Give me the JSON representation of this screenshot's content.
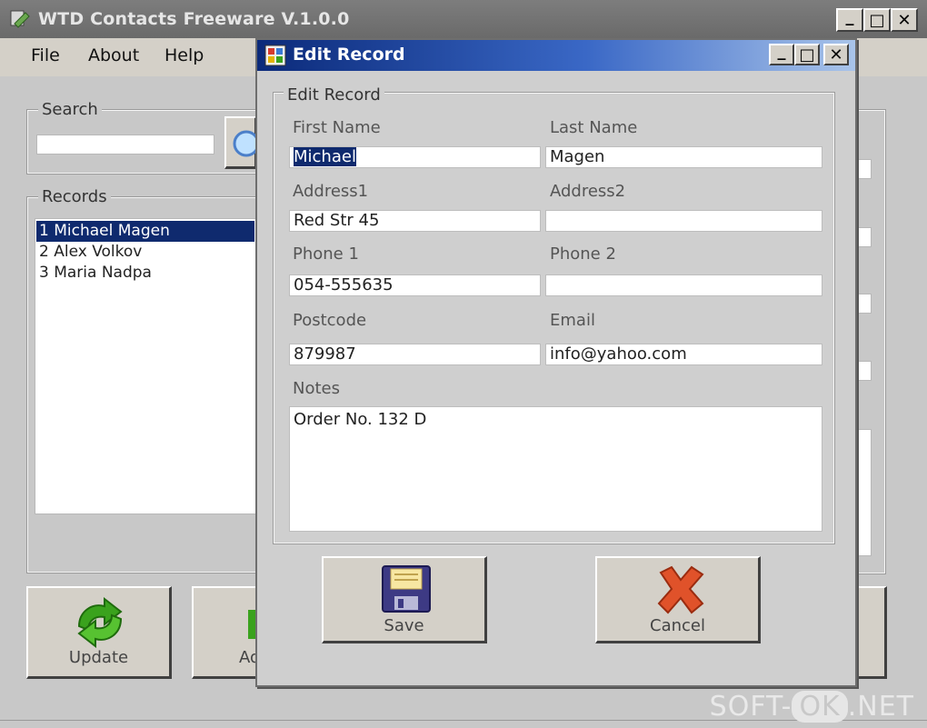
{
  "main_window": {
    "title": "WTD Contacts Freeware V.1.0.0",
    "controls": {
      "minimize": "_",
      "maximize": "□",
      "close": "✕"
    }
  },
  "menu": {
    "file": "File",
    "about": "About",
    "help": "Help"
  },
  "search": {
    "label": "Search",
    "value": ""
  },
  "records": {
    "label": "Records",
    "items": [
      {
        "text": "1 Michael Magen"
      },
      {
        "text": "2 Alex  Volkov"
      },
      {
        "text": "3 Maria  Nadpa"
      }
    ]
  },
  "main_buttons": {
    "update": "Update",
    "add_partial": "Ad"
  },
  "dialog": {
    "title": "Edit Record",
    "group_label": "Edit Record",
    "labels": {
      "first_name": "First Name",
      "last_name": "Last Name",
      "address1": "Address1",
      "address2": "Address2",
      "phone1": "Phone 1",
      "phone2": "Phone 2",
      "postcode": "Postcode",
      "email": "Email",
      "notes": "Notes"
    },
    "values": {
      "first_name": "Michael",
      "last_name": "Magen",
      "address1": "Red Str 45",
      "address2": "",
      "phone1": "054-555635",
      "phone2": "",
      "postcode": "879987",
      "email": "info@yahoo.com",
      "notes": "Order No. 132 D"
    },
    "save_label": "Save",
    "cancel_label": "Cancel"
  },
  "watermark": {
    "left": "SOFT-",
    "mid": "OK",
    "right": ".NET"
  },
  "colors": {
    "selection": "#0f2a6e",
    "title_gradient_start": "#0b2a7a",
    "title_gradient_end": "#a9c4ea",
    "update_icon": "#3aa21d",
    "cancel_icon": "#e0522a",
    "save_icon": "#3d3a84"
  }
}
